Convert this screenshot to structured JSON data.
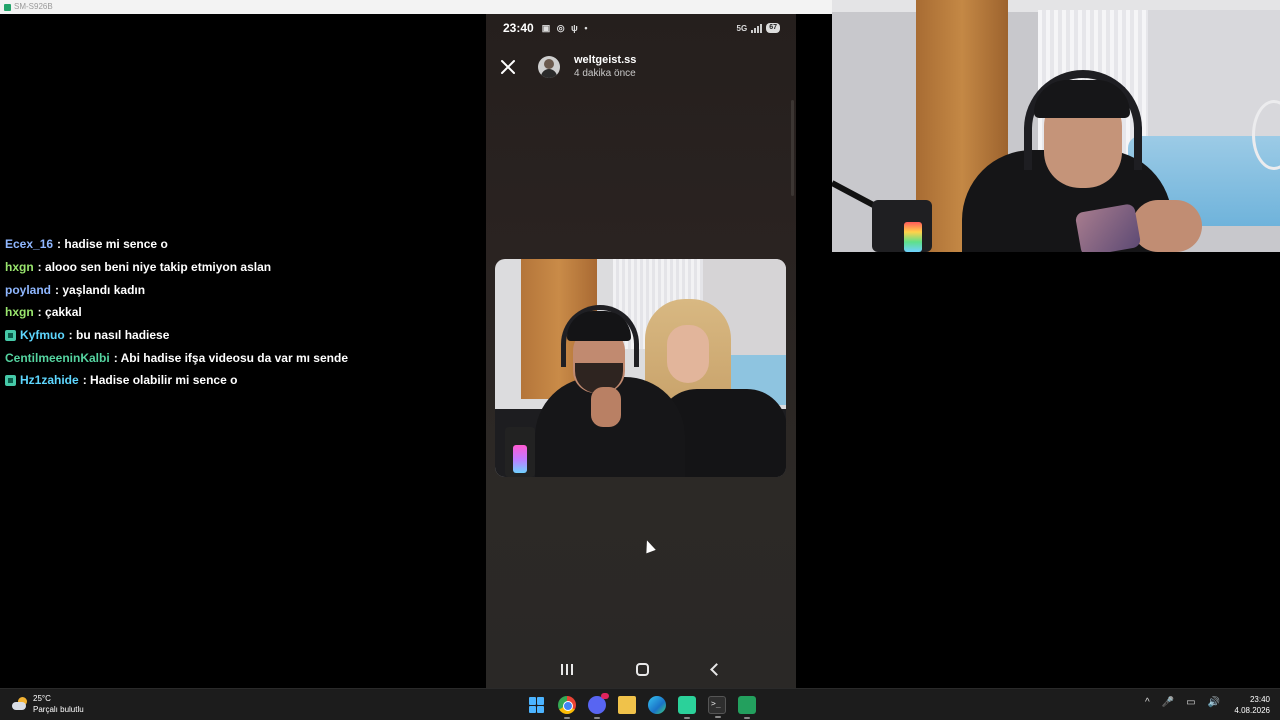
{
  "window": {
    "title": "SM-S926B"
  },
  "chat": [
    {
      "user": "Ecex_16",
      "color": "#8fb7ff",
      "badge": false,
      "message": "hadise mi sence o"
    },
    {
      "user": "hxgn",
      "color": "#9ae66e",
      "badge": false,
      "message": "alooo sen beni niye takip etmiyon aslan"
    },
    {
      "user": "poyland",
      "color": "#8fb7ff",
      "badge": false,
      "message": "yaşlandı kadın"
    },
    {
      "user": "hxgn",
      "color": "#9ae66e",
      "badge": false,
      "message": "çakkal"
    },
    {
      "user": "Kyfmuo",
      "color": "#5ed7ff",
      "badge": true,
      "message": "bu nasıl hadiese"
    },
    {
      "user": "CentilmeeninKalbi",
      "color": "#55d4a0",
      "badge": false,
      "message": "Abi hadise ifşa videosu da var mı sende"
    },
    {
      "user": "Hz1zahide",
      "color": "#5ed7ff",
      "badge": true,
      "message": "Hadise olabilir mi sence o"
    }
  ],
  "phone": {
    "status": {
      "time": "23:40",
      "icons": "▣ ◎ ψ •",
      "network": "5G",
      "battery": "67"
    },
    "story": {
      "username": "weltgeist.ss",
      "time_ago": "4 dakika önce",
      "close_icon": "close-icon"
    },
    "nav": {
      "recents_icon": "recents-icon",
      "home_icon": "home-icon",
      "back_icon": "back-icon"
    }
  },
  "taskbar": {
    "weather": {
      "temp": "25°C",
      "desc": "Parçalı bulutlu"
    },
    "apps": [
      "start-icon",
      "chrome-icon",
      "discord-icon",
      "file-explorer-icon",
      "edge-icon",
      "green-app-icon",
      "terminal-icon",
      "mirror-app-icon"
    ],
    "tray": [
      "^",
      "🎤",
      "▭",
      "🔊"
    ],
    "clock": {
      "time": "23:40",
      "date": "4.08.2026"
    }
  }
}
